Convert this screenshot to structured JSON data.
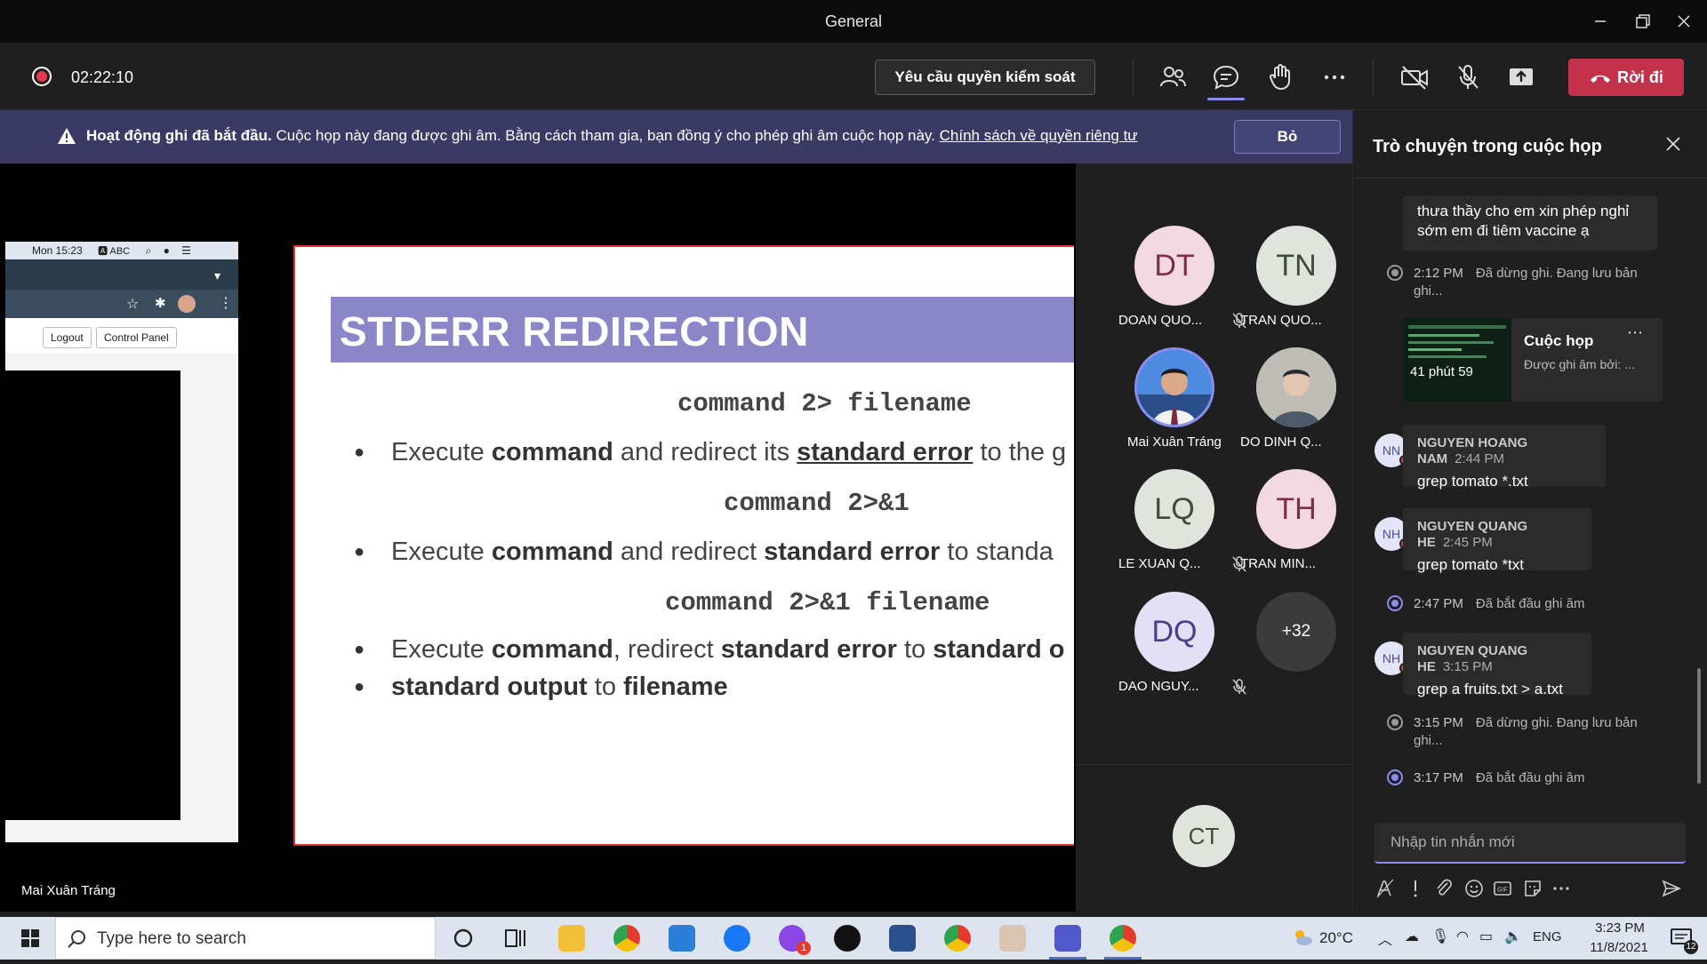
{
  "window": {
    "title": "General"
  },
  "toolbar": {
    "timer": "02:22:10",
    "request_control_label": "Yêu cầu quyền kiểm soát",
    "leave_label": "Rời đi"
  },
  "banner": {
    "bold_text": "Hoạt động ghi đã bắt đầu.",
    "text": "Cuộc họp này đang được ghi âm. Bằng cách tham gia, bạn đồng ý cho phép ghi âm cuộc họp này.",
    "link": "Chính sách về quyền riêng tư",
    "dismiss_label": "Bỏ"
  },
  "shared_screen": {
    "mac_menubar": "Mon 15:23",
    "logout_label": "Logout",
    "control_panel_label": "Control Panel",
    "slide_title": "STDERR REDIRECTION",
    "cmd1": "command 2> filename",
    "bullet1": {
      "pre": "Execute ",
      "b1": "command",
      "mid": " and redirect its ",
      "u1": "standard error",
      "post": " to the g"
    },
    "cmd2": "command 2>&1",
    "bullet2": {
      "pre": "Execute ",
      "b1": "command",
      "mid": " and redirect ",
      "b2": "standard error",
      "post": " to standa"
    },
    "cmd3": "command 2>&1 filename",
    "bullet3": {
      "pre": "Execute ",
      "b1": "command",
      "mid": ", redirect ",
      "b2": "standard error",
      "mid2": " to ",
      "b3": "standard o",
      "line2_b1": "standard output",
      "line2_mid": " to ",
      "line2_b2": "filename"
    },
    "presenter_name": "Mai Xuân Tráng"
  },
  "participants": [
    {
      "initials": "DT",
      "name": "DOAN QUO...",
      "muted": true
    },
    {
      "initials": "TN",
      "name": "TRAN QUO...",
      "muted": true
    },
    {
      "initials": "",
      "name": "Mai Xuân Tráng",
      "muted": false
    },
    {
      "initials": "",
      "name": "DO DINH Q...",
      "muted": true
    },
    {
      "initials": "LQ",
      "name": "LE XUAN Q...",
      "muted": true
    },
    {
      "initials": "TH",
      "name": "TRAN MIN...",
      "muted": true
    },
    {
      "initials": "DQ",
      "name": "DAO NGUY...",
      "muted": true
    },
    {
      "initials": "+32",
      "name": "",
      "muted": false
    }
  ],
  "self_tile": {
    "initials": "CT"
  },
  "chat": {
    "title": "Trò chuyện trong cuộc họp",
    "first_message": {
      "line1": "thưa thầy cho em xin phép nghỉ",
      "line2": "sớm em đi tiêm vaccine ạ"
    },
    "sys1": {
      "time": "2:12 PM",
      "text": "Đã dừng ghi. Đang lưu bản ghi..."
    },
    "recording_card": {
      "title": "Cuộc họp",
      "subtitle": "Được ghi âm bởi: ...",
      "duration": "41 phút 59"
    },
    "msg1": {
      "initials": "NN",
      "sender": "NGUYEN HOANG NAM",
      "time": "2:44 PM",
      "text": "grep tomato *.txt"
    },
    "msg2": {
      "initials": "NH",
      "sender": "NGUYEN QUANG HE",
      "time": "2:45 PM",
      "text": "grep tomato *txt"
    },
    "sys2": {
      "time": "2:47 PM",
      "text": "Đã bắt đầu ghi âm"
    },
    "msg3": {
      "initials": "NH",
      "sender": "NGUYEN QUANG HE",
      "time": "3:15 PM",
      "text": "grep a fruits.txt > a.txt"
    },
    "sys3": {
      "time": "3:15 PM",
      "text": "Đã dừng ghi. Đang lưu bản ghi..."
    },
    "sys4": {
      "time": "3:17 PM",
      "text": "Đã bắt đầu ghi âm"
    },
    "compose_placeholder": "Nhập tin nhắn mới"
  },
  "taskbar": {
    "search_placeholder": "Type here to search",
    "weather": "20°C",
    "lang": "ENG",
    "time": "3:23 PM",
    "date": "11/8/2021",
    "notifications": "12",
    "messenger_badge": "1"
  },
  "colors": {
    "accent": "#8b8cf0",
    "leave": "#c4314b",
    "banner": "#3b3a64",
    "slide_header": "#8b86c8"
  }
}
